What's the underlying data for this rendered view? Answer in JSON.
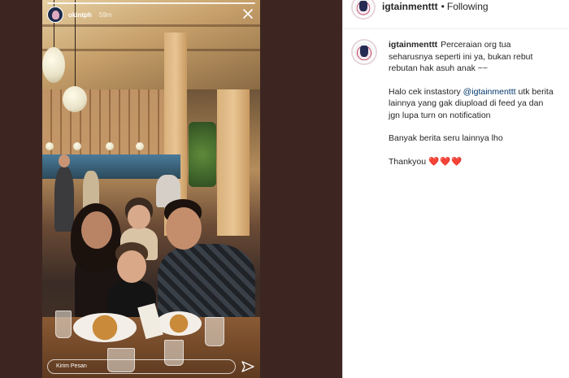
{
  "story": {
    "username": "okintph",
    "time_ago": "59m",
    "reply_placeholder": "Kirim Pesan"
  },
  "post": {
    "username": "igtainmenttt",
    "follow_label": "Following",
    "caption": {
      "intro": "Perceraian org tua seharusnya seperti ini ya, bukan rebut rebutan hak asuh anak ~~",
      "story_prefix": "Halo cek instastory ",
      "mention": "@igtainmenttt",
      "story_suffix": " utk berita lainnya yang gak diupload di feed ya dan jgn lupa turn on notification",
      "more_news": "Banyak berita seru lainnya lho",
      "thanks": "Thankyou",
      "hearts": "❤️❤️❤️"
    }
  },
  "colors": {
    "backdrop": "#3d2621",
    "link": "#00376b",
    "heart": "#e0245e"
  },
  "icons": [
    "close-icon",
    "send-icon",
    "avatar"
  ]
}
